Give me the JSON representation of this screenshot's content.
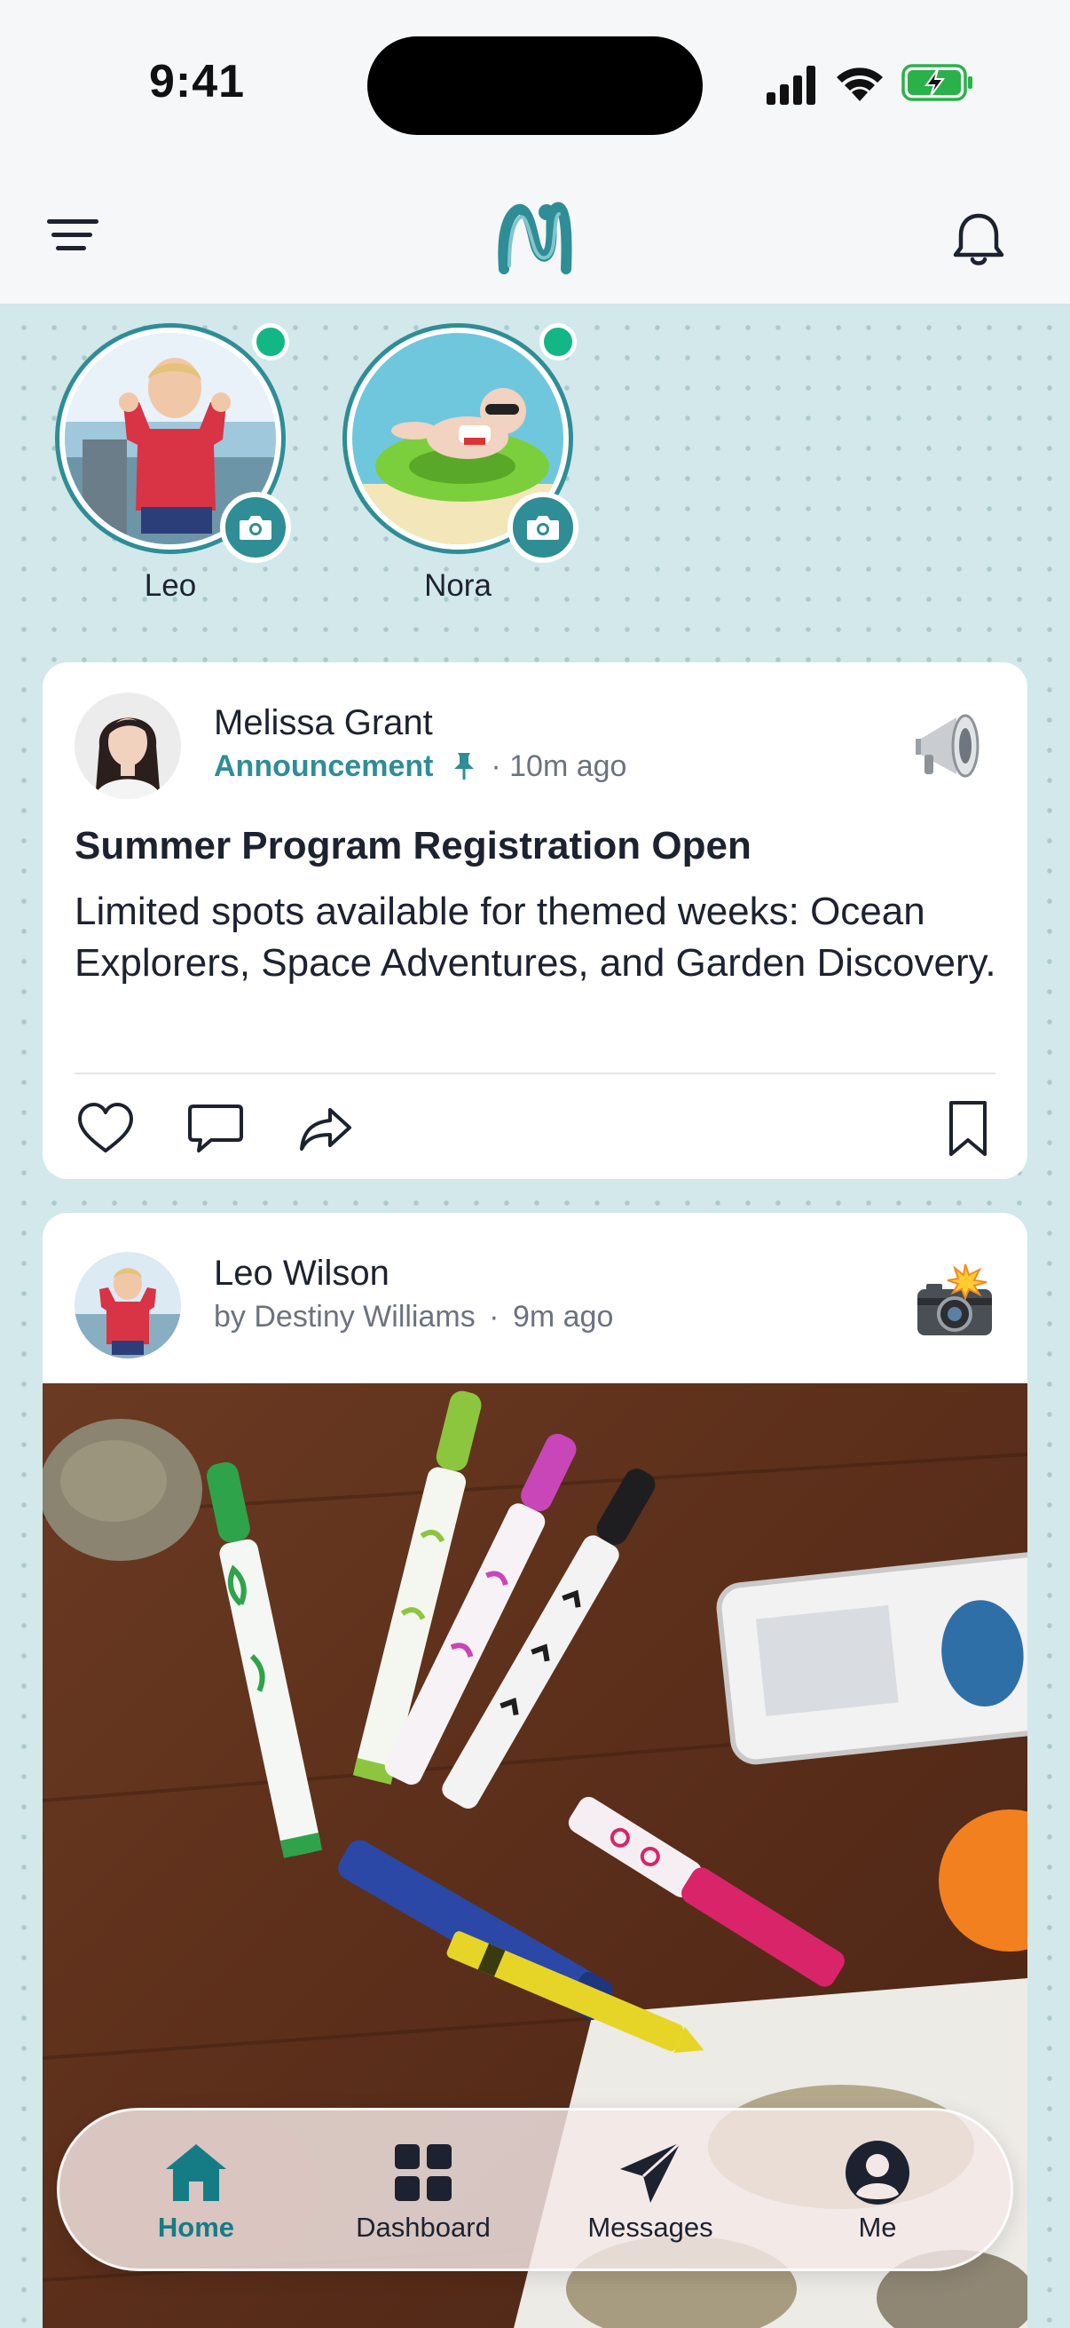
{
  "status_bar": {
    "time": "9:41"
  },
  "header": {
    "menu_icon": "hamburger-icon",
    "logo": "brand-logo",
    "bell_icon": "bell-icon"
  },
  "stories": [
    {
      "name": "Leo",
      "online": true
    },
    {
      "name": "Nora",
      "online": true
    }
  ],
  "posts": [
    {
      "author": "Melissa Grant",
      "category": "Announcement",
      "pinned": true,
      "time": "10m ago",
      "badge_icon": "megaphone-icon",
      "title": "Summer Program Registration Open",
      "body": "Limited spots available for themed weeks: Ocean Explorers, Space Adventures, and Garden Discovery."
    },
    {
      "author": "Leo Wilson",
      "byline": "by Destiny Williams",
      "time": "9m ago",
      "badge_icon": "camera-flash-icon"
    }
  ],
  "separator": "·",
  "tabbar": {
    "items": [
      {
        "label": "Home",
        "icon": "home-icon",
        "active": true
      },
      {
        "label": "Dashboard",
        "icon": "dashboard-icon",
        "active": false
      },
      {
        "label": "Messages",
        "icon": "paper-plane-icon",
        "active": false
      },
      {
        "label": "Me",
        "icon": "user-icon",
        "active": false
      }
    ]
  },
  "colors": {
    "accent": "#2f8d96",
    "online": "#13b785",
    "feed_bg": "#d2e8eb"
  }
}
